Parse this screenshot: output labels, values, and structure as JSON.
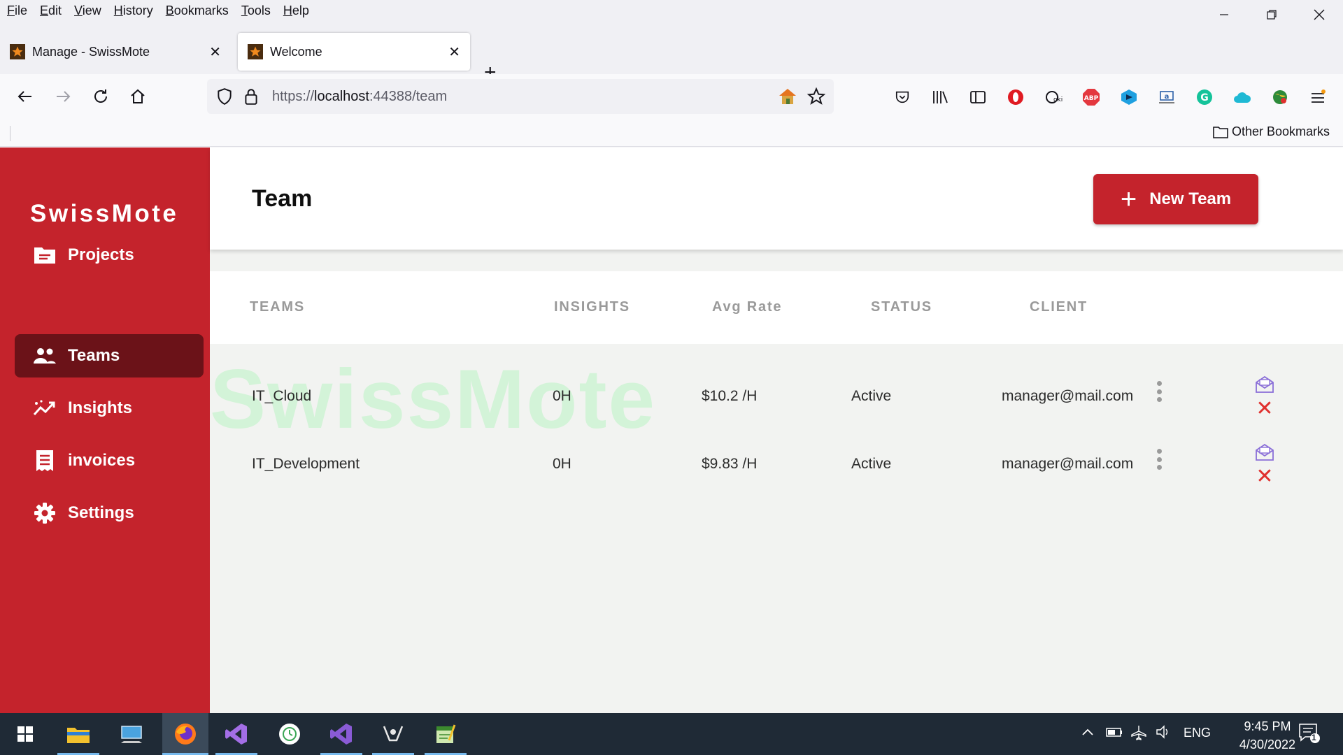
{
  "browser": {
    "menu": [
      "File",
      "Edit",
      "View",
      "History",
      "Bookmarks",
      "Tools",
      "Help"
    ],
    "tabs": [
      {
        "title": "Manage - SwissMote",
        "active": false
      },
      {
        "title": "Welcome",
        "active": true
      }
    ],
    "url": {
      "scheme": "https://",
      "host": "localhost",
      "rest": ":44388/team"
    },
    "bookmarks": {
      "other": "Other Bookmarks"
    },
    "extensions": [
      "pocket-icon",
      "library-icon",
      "sidebar-icon",
      "opera-icon",
      "grammar-icon",
      "abp-icon",
      "dev-icon",
      "amazon-icon",
      "grammarly-icon",
      "cloud-icon",
      "globe-icon",
      "menu-icon"
    ]
  },
  "app": {
    "brand": "SwissMote",
    "accent": "#c4232c",
    "nav": [
      {
        "label": "Projects",
        "icon": "folder-icon",
        "active": false
      },
      {
        "label": "Teams",
        "icon": "people-icon",
        "active": true
      },
      {
        "label": "Insights",
        "icon": "trending-icon",
        "active": false
      },
      {
        "label": "invoices",
        "icon": "receipt-icon",
        "active": false
      },
      {
        "label": "Settings",
        "icon": "gear-icon",
        "active": false
      }
    ],
    "page_title": "Team",
    "new_team_label": "New Team",
    "watermark": "SwissMote",
    "table": {
      "headers": [
        "TEAMS",
        "INSIGHTS",
        "Avg Rate",
        "STATUS",
        "CLIENT"
      ],
      "rows": [
        {
          "team": "IT_Cloud",
          "insights": "0H",
          "rate": "$10.2 /H",
          "status": "Active",
          "client": "manager@mail.com"
        },
        {
          "team": "IT_Development",
          "insights": "0H",
          "rate": "$9.83 /H",
          "status": "Active",
          "client": "manager@mail.com"
        }
      ]
    }
  },
  "taskbar": {
    "apps": [
      "windows-start-icon",
      "file-explorer-icon",
      "remote-desktop-icon",
      "firefox-icon",
      "visual-studio-icon",
      "clock-app-icon",
      "visual-studio-2-icon",
      "app-icon",
      "notepad-icon"
    ],
    "language": "ENG",
    "time": "9:45 PM",
    "date": "4/30/2022",
    "notifications": "1"
  }
}
